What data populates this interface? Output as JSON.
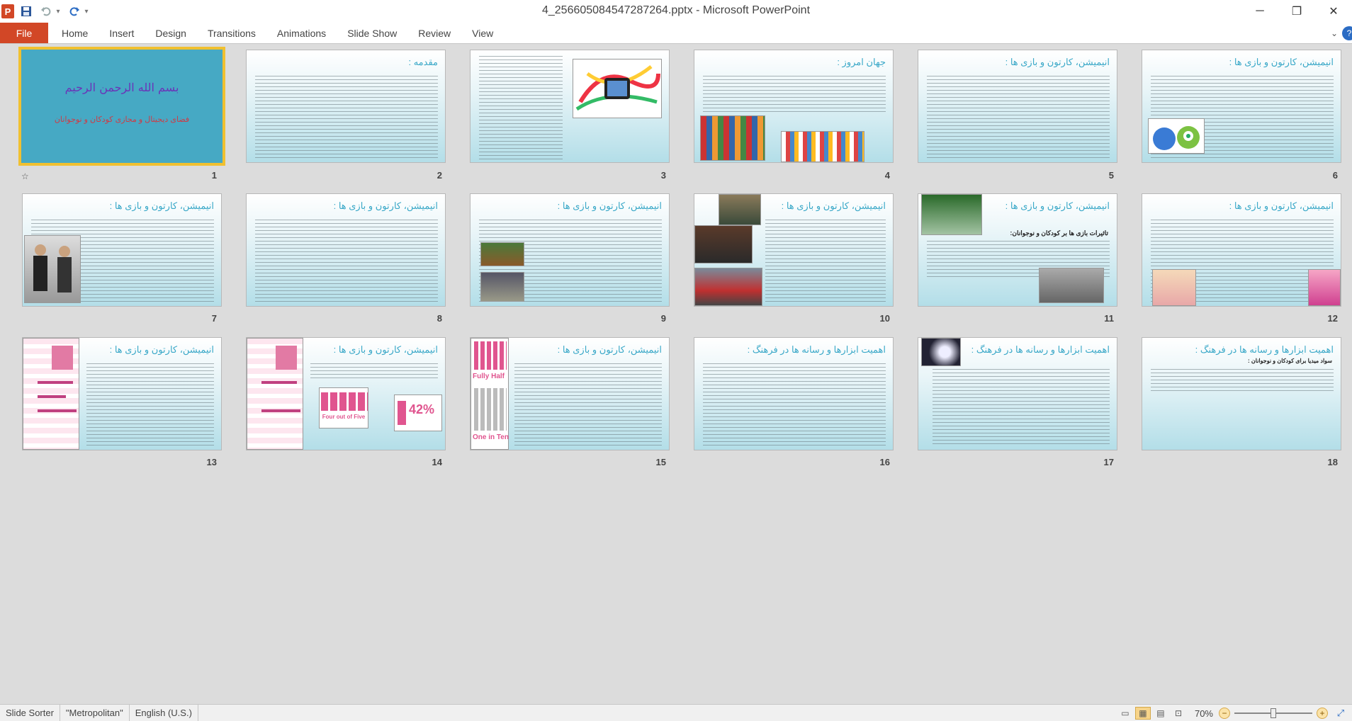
{
  "window": {
    "title": "4_256605084547287264.pptx  -  Microsoft PowerPoint",
    "app_icon": "P",
    "controls": [
      "minimize-icon",
      "restore-icon",
      "close-icon"
    ]
  },
  "quick_access": [
    "save-icon",
    "undo-icon",
    "redo-icon",
    "customize-icon"
  ],
  "ribbon": {
    "file_label": "File",
    "tabs": [
      "Home",
      "Insert",
      "Design",
      "Transitions",
      "Animations",
      "Slide Show",
      "Review",
      "View"
    ],
    "help_label": "?"
  },
  "colors": {
    "file_tab": "#d24726",
    "slide_title": "#3aa8c8",
    "cover_background": "#46a9c4",
    "cover_title": "#6b33b8",
    "cover_subtitle": "#d03a44",
    "selection": "#f0c030"
  },
  "slides": [
    {
      "number": "1",
      "title": "بسم الله الرحمن الرحیم",
      "subtitle": "فضای دیجیتال و مجازی کودکان و نوجوانان",
      "cover": true,
      "selected": true
    },
    {
      "number": "2",
      "title": "مقدمه :"
    },
    {
      "number": "3",
      "title": ""
    },
    {
      "number": "4",
      "title": "جهان امروز :"
    },
    {
      "number": "5",
      "title": "انیمیشن، کارتون و بازی ها :"
    },
    {
      "number": "6",
      "title": "انیمیشن، کارتون و بازی ها :"
    },
    {
      "number": "7",
      "title": "انیمیشن، کارتون و بازی ها :"
    },
    {
      "number": "8",
      "title": "انیمیشن، کارتون و بازی ها :"
    },
    {
      "number": "9",
      "title": "انیمیشن، کارتون و بازی ها :"
    },
    {
      "number": "10",
      "title": "انیمیشن، کارتون و بازی ها :"
    },
    {
      "number": "11",
      "title": "انیمیشن، کارتون و بازی ها :"
    },
    {
      "number": "12",
      "title": "انیمیشن، کارتون و بازی ها :"
    },
    {
      "number": "13",
      "title": "انیمیشن، کارتون و بازی ها :"
    },
    {
      "number": "14",
      "title": "انیمیشن، کارتون و بازی ها :"
    },
    {
      "number": "15",
      "title": "انیمیشن، کارتون و بازی ها :"
    },
    {
      "number": "16",
      "title": "اهمیت ابزارها و رسانه ها در فرهنگ :"
    },
    {
      "number": "17",
      "title": "اهمیت ابزارها و رسانه ها در فرهنگ :"
    },
    {
      "number": "18",
      "title": "اهمیت ابزارها و رسانه ها در فرهنگ :"
    }
  ],
  "slide_texts": {
    "s11_heading": "تاثیرات بازی ها بر کودکان و نوجوانان:",
    "s14_stat_a": "Four out of Five",
    "s14_stat_b": "42%",
    "s15_stat_a": "Fully Half",
    "s15_stat_b": "One in Ten",
    "s18_heading": "سواد میدیا برای کودکان و نوجوانان :"
  },
  "status": {
    "view_name": "Slide Sorter",
    "theme": "\"Metropolitan\"",
    "language": "English (U.S.)",
    "zoom": "70%",
    "zoom_fraction": 0.5,
    "views": [
      "normal-view-icon",
      "slide-sorter-view-icon",
      "reading-view-icon",
      "slide-show-view-icon"
    ]
  }
}
